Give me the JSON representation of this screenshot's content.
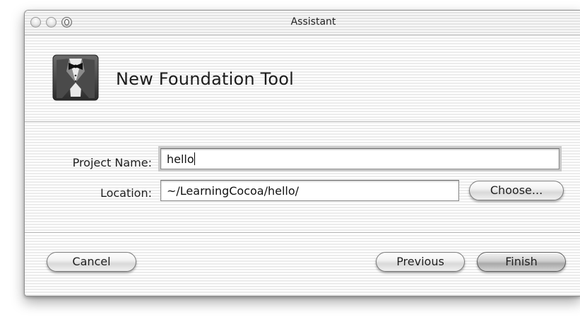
{
  "window": {
    "title": "Assistant"
  },
  "header": {
    "title": "New Foundation Tool",
    "icon": "tuxedo-icon"
  },
  "form": {
    "project_name_label": "Project Name:",
    "project_name_value": "hello",
    "location_label": "Location:",
    "location_value": "~/LearningCocoa/hello/",
    "choose_label": "Choose..."
  },
  "footer": {
    "cancel_label": "Cancel",
    "previous_label": "Previous",
    "finish_label": "Finish"
  }
}
